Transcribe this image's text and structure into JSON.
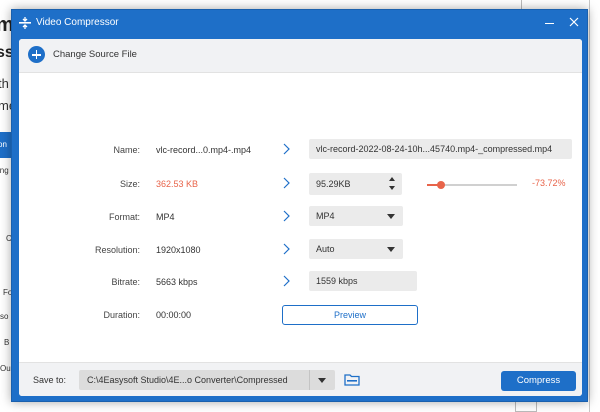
{
  "background": {
    "fragments": [
      "mp",
      "ss",
      "th",
      "me",
      "on",
      "ing",
      "C",
      "Fo",
      "so",
      "B",
      "Ou"
    ]
  },
  "window": {
    "title": "Video Compressor"
  },
  "toolbar": {
    "change_source_label": "Change Source File"
  },
  "form": {
    "name": {
      "label": "Name:",
      "source": "vlc-record...0.mp4-.mp4",
      "output": "vlc-record-2022-08-24-10h...45740.mp4-_compressed.mp4"
    },
    "size": {
      "label": "Size:",
      "source": "362.53 KB",
      "output": "95.29KB",
      "reduction": "-73.72%",
      "slider_fraction": 0.16
    },
    "format": {
      "label": "Format:",
      "source": "MP4",
      "output": "MP4"
    },
    "resolution": {
      "label": "Resolution:",
      "source": "1920x1080",
      "output": "Auto"
    },
    "bitrate": {
      "label": "Bitrate:",
      "source": "5663 kbps",
      "output": "1559 kbps"
    },
    "duration": {
      "label": "Duration:",
      "source": "00:00:00"
    },
    "preview_label": "Preview"
  },
  "footer": {
    "save_to_label": "Save to:",
    "path": "C:\\4Easysoft Studio\\4E...o Converter\\Compressed",
    "compress_label": "Compress"
  },
  "colors": {
    "accent": "#1e6fc8",
    "reduction": "#e8644a"
  }
}
